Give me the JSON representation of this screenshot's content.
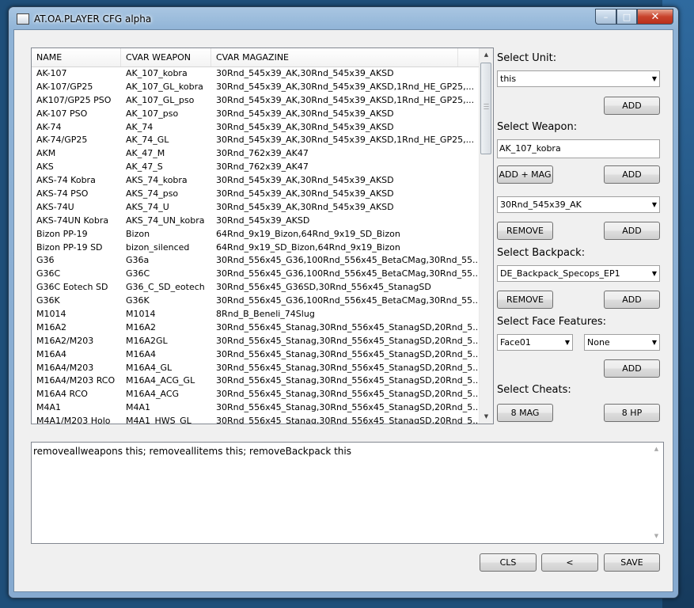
{
  "window": {
    "title": "AT.OA.PLAYER CFG alpha",
    "min_glyph": "–",
    "max_glyph": "□",
    "close_glyph": "✕"
  },
  "weapons_list": {
    "columns": [
      "NAME",
      "CVAR WEAPON",
      "CVAR MAGAZINE"
    ],
    "rows": [
      [
        "AK-107",
        "AK_107_kobra",
        "30Rnd_545x39_AK,30Rnd_545x39_AKSD"
      ],
      [
        "AK-107/GP25",
        "AK_107_GL_kobra",
        "30Rnd_545x39_AK,30Rnd_545x39_AKSD,1Rnd_HE_GP25,..."
      ],
      [
        "AK107/GP25 PSO",
        "AK_107_GL_pso",
        "30Rnd_545x39_AK,30Rnd_545x39_AKSD,1Rnd_HE_GP25,..."
      ],
      [
        "AK-107 PSO",
        "AK_107_pso",
        "30Rnd_545x39_AK,30Rnd_545x39_AKSD"
      ],
      [
        "AK-74",
        "AK_74",
        "30Rnd_545x39_AK,30Rnd_545x39_AKSD"
      ],
      [
        "AK-74/GP25",
        "AK_74_GL",
        "30Rnd_545x39_AK,30Rnd_545x39_AKSD,1Rnd_HE_GP25,..."
      ],
      [
        "AKM",
        "AK_47_M",
        "30Rnd_762x39_AK47"
      ],
      [
        "AKS",
        "AK_47_S",
        "30Rnd_762x39_AK47"
      ],
      [
        "AKS-74 Kobra",
        "AKS_74_kobra",
        "30Rnd_545x39_AK,30Rnd_545x39_AKSD"
      ],
      [
        "AKS-74 PSO",
        "AKS_74_pso",
        "30Rnd_545x39_AK,30Rnd_545x39_AKSD"
      ],
      [
        "AKS-74U",
        "AKS_74_U",
        "30Rnd_545x39_AK,30Rnd_545x39_AKSD"
      ],
      [
        "AKS-74UN Kobra",
        "AKS_74_UN_kobra",
        "30Rnd_545x39_AKSD"
      ],
      [
        "Bizon PP-19",
        "Bizon",
        "64Rnd_9x19_Bizon,64Rnd_9x19_SD_Bizon"
      ],
      [
        "Bizon PP-19 SD",
        "bizon_silenced",
        "64Rnd_9x19_SD_Bizon,64Rnd_9x19_Bizon"
      ],
      [
        "G36",
        "G36a",
        "30Rnd_556x45_G36,100Rnd_556x45_BetaCMag,30Rnd_55..."
      ],
      [
        "G36C",
        "G36C",
        "30Rnd_556x45_G36,100Rnd_556x45_BetaCMag,30Rnd_55..."
      ],
      [
        "G36C Eotech SD",
        "G36_C_SD_eotech",
        "30Rnd_556x45_G36SD,30Rnd_556x45_StanagSD"
      ],
      [
        "G36K",
        "G36K",
        "30Rnd_556x45_G36,100Rnd_556x45_BetaCMag,30Rnd_55..."
      ],
      [
        "M1014",
        "M1014",
        "8Rnd_B_Beneli_74Slug"
      ],
      [
        "M16A2",
        "M16A2",
        "30Rnd_556x45_Stanag,30Rnd_556x45_StanagSD,20Rnd_5..."
      ],
      [
        "M16A2/M203",
        "M16A2GL",
        "30Rnd_556x45_Stanag,30Rnd_556x45_StanagSD,20Rnd_5..."
      ],
      [
        "M16A4",
        "M16A4",
        "30Rnd_556x45_Stanag,30Rnd_556x45_StanagSD,20Rnd_5..."
      ],
      [
        "M16A4/M203",
        "M16A4_GL",
        "30Rnd_556x45_Stanag,30Rnd_556x45_StanagSD,20Rnd_5..."
      ],
      [
        "M16A4/M203 RCO",
        "M16A4_ACG_GL",
        "30Rnd_556x45_Stanag,30Rnd_556x45_StanagSD,20Rnd_5..."
      ],
      [
        "M16A4 RCO",
        "M16A4_ACG",
        "30Rnd_556x45_Stanag,30Rnd_556x45_StanagSD,20Rnd_5..."
      ],
      [
        "M4A1",
        "M4A1",
        "30Rnd_556x45_Stanag,30Rnd_556x45_StanagSD,20Rnd_5..."
      ],
      [
        "M4A1/M203 Holo",
        "M4A1_HWS_GL",
        "30Rnd_556x45_Stanag,30Rnd_556x45_StanagSD,20Rnd_5..."
      ]
    ]
  },
  "unit": {
    "label": "Select Unit:",
    "selected": "this",
    "add_label": "ADD"
  },
  "weapon": {
    "label": "Select Weapon:",
    "value": "AK_107_kobra",
    "add_mag_label": "ADD + MAG",
    "add_label": "ADD"
  },
  "magazine": {
    "selected": "30Rnd_545x39_AK",
    "remove_label": "REMOVE",
    "add_label": "ADD"
  },
  "backpack": {
    "label": "Select Backpack:",
    "selected": "DE_Backpack_Specops_EP1",
    "remove_label": "REMOVE",
    "add_label": "ADD"
  },
  "face": {
    "label": "Select Face Features:",
    "face_selected": "Face01",
    "extra_selected": "None",
    "add_label": "ADD"
  },
  "cheats": {
    "label": "Select Cheats:",
    "mag_label": "8 MAG",
    "hp_label": "8 HP"
  },
  "output": {
    "text": "removeallweapons this; removeallitems this; removeBackpack this"
  },
  "bottom": {
    "cls_label": "CLS",
    "back_label": "<",
    "save_label": "SAVE"
  }
}
